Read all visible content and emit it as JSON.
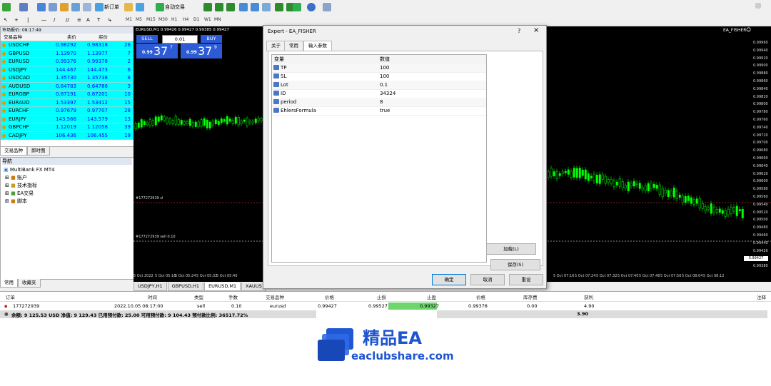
{
  "toolbar": {
    "new_order": "新订单",
    "auto_trading": "自动交易",
    "timeframes": [
      "M1",
      "M5",
      "M15",
      "M30",
      "H1",
      "H4",
      "D1",
      "W1",
      "MN"
    ]
  },
  "market_watch": {
    "header": "市场报价: 08:17:49",
    "col_symbol": "交易品种",
    "col_bid": "卖价",
    "col_ask": "买价",
    "rows": [
      {
        "symbol": "USDCHF",
        "bid": "0.98292",
        "ask": "0.98318",
        "spread": "26"
      },
      {
        "symbol": "GBPUSD",
        "bid": "1.13970",
        "ask": "1.13977",
        "spread": "7"
      },
      {
        "symbol": "EURUSD",
        "bid": "0.99376",
        "ask": "0.99378",
        "spread": "2"
      },
      {
        "symbol": "USDJPY",
        "bid": "144.467",
        "ask": "144.473",
        "spread": "6"
      },
      {
        "symbol": "USDCAD",
        "bid": "1.35730",
        "ask": "1.35738",
        "spread": "8"
      },
      {
        "symbol": "AUDUSD",
        "bid": "0.64783",
        "ask": "0.64786",
        "spread": "3"
      },
      {
        "symbol": "EURGBP",
        "bid": "0.87191",
        "ask": "0.87201",
        "spread": "10"
      },
      {
        "symbol": "EURAUD",
        "bid": "1.53397",
        "ask": "1.53412",
        "spread": "15"
      },
      {
        "symbol": "EURCHF",
        "bid": "0.97679",
        "ask": "0.97707",
        "spread": "28"
      },
      {
        "symbol": "EURJPY",
        "bid": "143.566",
        "ask": "143.579",
        "spread": "13"
      },
      {
        "symbol": "GBPCHF",
        "bid": "1.12019",
        "ask": "1.12058",
        "spread": "39"
      },
      {
        "symbol": "CADJPY",
        "bid": "106.436",
        "ask": "106.455",
        "spread": "19"
      }
    ],
    "tabs": [
      "交易品种",
      "即时图"
    ]
  },
  "navigator": {
    "header": "导航",
    "root": "MultiBank FX MT4",
    "items": [
      "账户",
      "技术指标",
      "EA交易",
      "脚本"
    ],
    "tabs": [
      "常用",
      "收藏夹"
    ]
  },
  "chart": {
    "info": "EURUSD,M1  0.99426 0.99427 0.99385 0.99427",
    "ea_label": "EA_FISHER",
    "sell_label": "SELL",
    "buy_label": "BUY",
    "lot": "0.01",
    "sell_small": "0.99",
    "sell_big": "37",
    "sell_sup": "7",
    "buy_small": "0.99",
    "buy_big": "37",
    "buy_sup": "9",
    "order_line_1": "#177272939 sl",
    "order_line_2": "#177272939 sell 0.10",
    "price_scale": [
      "0.99960",
      "0.99940",
      "0.99920",
      "0.99900",
      "0.99880",
      "0.99860",
      "0.99840",
      "0.99820",
      "0.99800",
      "0.99780",
      "0.99760",
      "0.99740",
      "0.99720",
      "0.99700",
      "0.99680",
      "0.99660",
      "0.99640",
      "0.99620",
      "0.99600",
      "0.99580",
      "0.99560",
      "0.99540",
      "0.99520",
      "0.99500",
      "0.99480",
      "0.99460",
      "0.99440",
      "0.99420",
      "0.99400",
      "0.99380"
    ],
    "current_price": "0.99427",
    "time_labels_left": [
      "5 Oct 2022",
      "5 Oct 05:16",
      "5 Oct 05:24",
      "5 Oct 05:32",
      "5 Oct 05:40"
    ],
    "time_labels_right": [
      "5 Oct 07:16",
      "5 Oct 07:24",
      "5 Oct 07:32",
      "5 Oct 07:40",
      "5 Oct 07:48",
      "5 Oct 07:56",
      "5 Oct 08:04",
      "5 Oct 08:12"
    ],
    "tabs": [
      "USDJPY,H1",
      "GBPUSD,H1",
      "EURUSD,M1",
      "XAUUS"
    ]
  },
  "dialog": {
    "title": "Expert - EA_FISHER",
    "help": "?",
    "close": "×",
    "tabs": [
      "关于",
      "常用",
      "输入参数"
    ],
    "col_var": "变量",
    "col_val": "数值",
    "params": [
      {
        "name": "TP",
        "value": "100"
      },
      {
        "name": "SL",
        "value": "100"
      },
      {
        "name": "Lot",
        "value": "0.1"
      },
      {
        "name": "ID",
        "value": "34324"
      },
      {
        "name": "period",
        "value": "8"
      },
      {
        "name": "EhlersFormula",
        "value": "true"
      }
    ],
    "load_btn": "加载(L)",
    "save_btn": "保存(S)",
    "ok_btn": "确定",
    "cancel_btn": "取消",
    "reset_btn": "重设"
  },
  "terminal": {
    "headers": {
      "order": "订单",
      "time": "时间",
      "type": "类型",
      "lots": "手数",
      "symbol": "交易品种",
      "price": "价格",
      "sl": "止损",
      "tp": "止盈",
      "cur_price": "价格",
      "swap": "库存费",
      "profit": "获利",
      "comment": "注释"
    },
    "row": {
      "order": "177272939",
      "time": "2022.10.05 08:17:00",
      "type": "sell",
      "lots": "0.10",
      "symbol": "eurusd",
      "price": "0.99427",
      "sl": "0.99527",
      "tp": "0.99327",
      "cur_price": "0.99378",
      "swap": "0.00",
      "profit": "4.90"
    },
    "summary": "余额: 9 125.53 USD  净值: 9 129.43  已用预付款: 25.00  可用预付款: 9 104.43  预付款比例: 36517.72%",
    "summary_profit": "3.90"
  },
  "watermark": {
    "brand": "精品EA",
    "url": "eaclubshare.com"
  }
}
